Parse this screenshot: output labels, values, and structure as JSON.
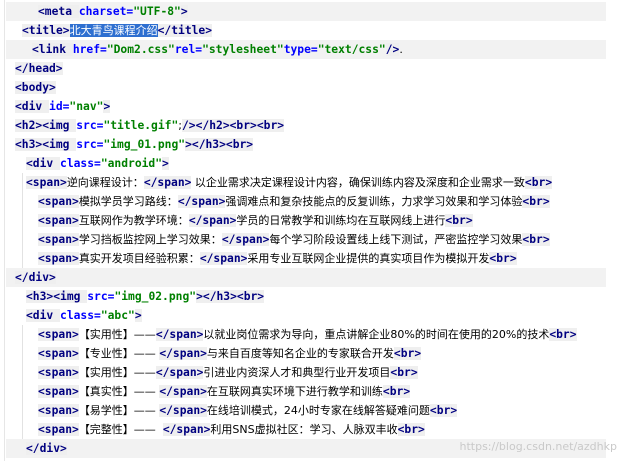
{
  "lines": [
    [
      [
        "tag",
        "<meta "
      ],
      [
        "attr",
        "charset="
      ],
      [
        "val",
        "\"UTF-8\""
      ],
      [
        "tag",
        ">"
      ]
    ],
    [
      [
        "tag",
        "<title>"
      ],
      [
        "sel",
        "北大青鸟课程介绍"
      ],
      [
        "tag",
        "</title>"
      ]
    ],
    [
      [
        "tag",
        "<link "
      ],
      [
        "attr",
        "href="
      ],
      [
        "val",
        "\"Dom2.css\""
      ],
      [
        "attr",
        "rel="
      ],
      [
        "val",
        "\"stylesheet\""
      ],
      [
        "attr",
        "type="
      ],
      [
        "val",
        "\"text/css\""
      ],
      [
        "tag",
        "/>"
      ],
      [
        "txt",
        "."
      ]
    ],
    [
      [
        "tag",
        "</head>"
      ]
    ],
    [
      [
        "tag",
        "<body>"
      ]
    ],
    [
      [
        "tag",
        "<div "
      ],
      [
        "attr",
        "id="
      ],
      [
        "val",
        "\"nav\""
      ],
      [
        "tag",
        ">"
      ]
    ],
    [
      [
        "tag",
        "<h2>"
      ],
      [
        "tag",
        "<img "
      ],
      [
        "attr",
        "src="
      ],
      [
        "val",
        "\"title.gif\""
      ],
      [
        "txt",
        ";"
      ],
      [
        "tag",
        "/>"
      ],
      [
        "tag",
        "</h2>"
      ],
      [
        "tag",
        "<br>"
      ],
      [
        "tag",
        "<br>"
      ]
    ],
    [
      [
        "tag",
        "<h3>"
      ],
      [
        "tag",
        "<img "
      ],
      [
        "attr",
        "src="
      ],
      [
        "val",
        "\"img_01.png\""
      ],
      [
        "tag",
        ">"
      ],
      [
        "tag",
        "</h3>"
      ],
      [
        "tag",
        "<br>"
      ]
    ],
    [
      [
        "tag",
        "<div "
      ],
      [
        "attr",
        "class="
      ],
      [
        "val",
        "\"android\""
      ],
      [
        "tag",
        ">"
      ]
    ],
    [
      [
        "tag",
        "<span>"
      ],
      [
        "txt",
        "逆向课程设计："
      ],
      [
        "tag",
        "</span>"
      ],
      [
        "txt",
        " 以企业需求决定课程设计内容，确保训练内容及深度和企业需求一致"
      ],
      [
        "tag",
        "<br>"
      ]
    ],
    [
      [
        "tag",
        "<span>"
      ],
      [
        "txt",
        "模拟学员学习路线："
      ],
      [
        "tag",
        "</span>"
      ],
      [
        "txt",
        "强调难点和复杂技能点的反复训练，力求学习效果和学习体验"
      ],
      [
        "tag",
        "<br>"
      ]
    ],
    [
      [
        "tag",
        "<span>"
      ],
      [
        "txt",
        "互联网作为教学环境："
      ],
      [
        "tag",
        "</span>"
      ],
      [
        "txt",
        "学员的日常教学和训练均在互联网线上进行"
      ],
      [
        "tag",
        "<br>"
      ]
    ],
    [
      [
        "tag",
        "<span>"
      ],
      [
        "txt",
        "学习挡板监控网上学习效果："
      ],
      [
        "tag",
        "</span>"
      ],
      [
        "txt",
        "每个学习阶段设置线上线下测试，严密监控学习效果"
      ],
      [
        "tag",
        "<br>"
      ]
    ],
    [
      [
        "tag",
        "<span>"
      ],
      [
        "txt",
        "真实开发项目经验积累："
      ],
      [
        "tag",
        "</span>"
      ],
      [
        "txt",
        "采用专业互联网企业提供的真实项目作为模拟开发"
      ],
      [
        "tag",
        "<br>"
      ]
    ],
    [
      [
        "tag",
        "</div>"
      ]
    ],
    [
      [
        "tag",
        "<h3>"
      ],
      [
        "tag",
        "<img "
      ],
      [
        "attr",
        "src="
      ],
      [
        "val",
        "\"img_02.png\""
      ],
      [
        "tag",
        ">"
      ],
      [
        "tag",
        "</h3>"
      ],
      [
        "tag",
        "<br>"
      ]
    ],
    [
      [
        "tag",
        "<div "
      ],
      [
        "attr",
        "class="
      ],
      [
        "val",
        "\"abc\""
      ],
      [
        "tag",
        ">"
      ]
    ],
    [
      [
        "tag",
        "<span>"
      ],
      [
        "txt",
        "【实用性】——"
      ],
      [
        "tag",
        "</span>"
      ],
      [
        "txt",
        "以就业岗位需求为导向，重点讲解企业80%的时间在使用的20%的技术"
      ],
      [
        "tag",
        "<br>"
      ]
    ],
    [
      [
        "tag",
        "<span>"
      ],
      [
        "txt",
        "【专业性】—— "
      ],
      [
        "tag",
        "</span>"
      ],
      [
        "txt",
        "与来自百度等知名企业的专家联合开发"
      ],
      [
        "tag",
        "<br>"
      ]
    ],
    [
      [
        "tag",
        "<span>"
      ],
      [
        "txt",
        "【实用性】——"
      ],
      [
        "tag",
        "</span>"
      ],
      [
        "txt",
        "引进业内资深人才和典型行业开发项目"
      ],
      [
        "tag",
        "<br>"
      ]
    ],
    [
      [
        "tag",
        "<span>"
      ],
      [
        "txt",
        "【真实性】—— "
      ],
      [
        "tag",
        "</span>"
      ],
      [
        "txt",
        "在互联网真实环境下进行教学和训练"
      ],
      [
        "tag",
        "<br>"
      ]
    ],
    [
      [
        "tag",
        "<span>"
      ],
      [
        "txt",
        "【易学性】—— "
      ],
      [
        "tag",
        "</span>"
      ],
      [
        "txt",
        "在线培训模式，24小时专家在线解答疑难问题"
      ],
      [
        "tag",
        "<br>"
      ]
    ],
    [
      [
        "tag",
        "<span>"
      ],
      [
        "txt",
        "【完整性】——  "
      ],
      [
        "tag",
        "</span>"
      ],
      [
        "txt",
        "利用SNS虚拟社区：学习、人脉双丰收"
      ],
      [
        "tag",
        "<br>"
      ]
    ],
    [
      [
        "tag",
        "</div>"
      ]
    ]
  ],
  "watermark": "https://blog.csdn.net/azdhkp"
}
